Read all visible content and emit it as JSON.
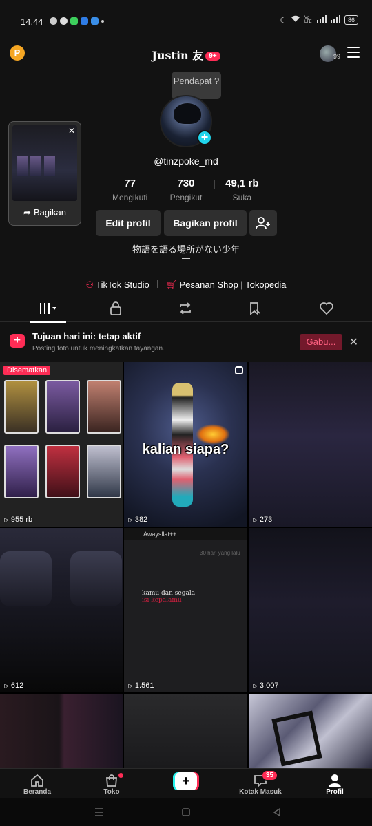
{
  "status_bar": {
    "time": "14.44",
    "battery": "86",
    "signal_label": "Vo LTE",
    "colors": {
      "notif1": "#9aa0ff",
      "notif2": "#3dcf5c",
      "notif3": "#2f7ce5",
      "notif4": "#3a8ee8"
    }
  },
  "header": {
    "coin_label": "P",
    "title": "Justin 友",
    "title_badge": "9+",
    "avatar_count": "99"
  },
  "profile": {
    "tooltip": "Pendapat ?",
    "username": "@tinzpoke_md",
    "stats": [
      {
        "value": "77",
        "label": "Mengikuti"
      },
      {
        "value": "730",
        "label": "Pengikut"
      },
      {
        "value": "49,1 rb",
        "label": "Suka"
      }
    ],
    "buttons": {
      "edit": "Edit profil",
      "share": "Bagikan profil"
    },
    "bio": "物語を語る場所がない少年",
    "links": [
      {
        "label": "TikTok Studio",
        "icon": "person-icon"
      },
      {
        "label": "Pesanan Shop | Tokopedia",
        "icon": "cart-icon"
      }
    ],
    "share_card": {
      "label": "Bagikan"
    }
  },
  "tabs": [
    {
      "name": "videos-tab",
      "icon": "grid-icon",
      "active": true
    },
    {
      "name": "private-tab",
      "icon": "lock-icon",
      "active": false
    },
    {
      "name": "reposts-tab",
      "icon": "repost-icon",
      "active": false
    },
    {
      "name": "favorites-tab",
      "icon": "bookmark-icon",
      "active": false
    },
    {
      "name": "liked-tab",
      "icon": "heart-icon",
      "active": false
    }
  ],
  "banner": {
    "title": "Tujuan hari ini: tetap aktif",
    "subtitle": "Posting foto untuk meningkatkan tayangan.",
    "action": "Gabu...",
    "accent": "#fe2c55"
  },
  "grid": {
    "pinned_label": "Disematkan",
    "videos": [
      {
        "views": "955 rb"
      },
      {
        "views": "382",
        "caption": "kalian siapa?"
      },
      {
        "views": "273"
      },
      {
        "views": "612"
      },
      {
        "views": "1.561",
        "top_text": "Awaysllat++",
        "faint_text": "30 hari yang lalu",
        "msg1": "kamu dan segala",
        "msg2": "isi kepalamu"
      },
      {
        "views": "3.007"
      }
    ]
  },
  "bottom_nav": {
    "items": [
      {
        "label": "Beranda",
        "icon": "home-icon"
      },
      {
        "label": "Toko",
        "icon": "shop-icon"
      },
      {
        "label": "",
        "icon": "create-icon"
      },
      {
        "label": "Kotak Masuk",
        "icon": "inbox-icon",
        "badge": "35"
      },
      {
        "label": "Profil",
        "icon": "profile-icon"
      }
    ]
  }
}
